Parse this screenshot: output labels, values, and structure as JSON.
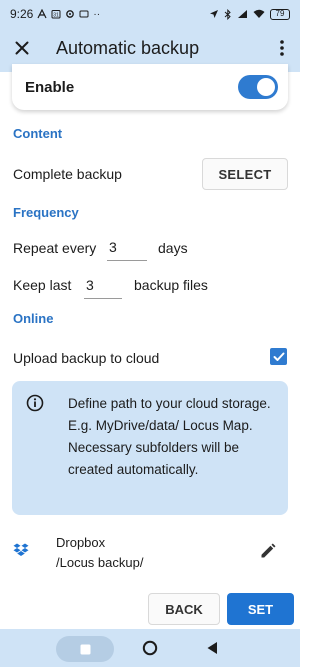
{
  "status_bar": {
    "time": "9:26",
    "battery": "79",
    "left_icons": [
      "app-icon",
      "calendar-icon",
      "settings-icon",
      "message-icon"
    ],
    "left_dots": "··",
    "right_icons": [
      "location-icon",
      "bluetooth-icon",
      "signal-icon",
      "wifi-icon",
      "battery-icon"
    ]
  },
  "toolbar": {
    "title": "Automatic backup",
    "close_icon": "close-icon",
    "more_icon": "more-vert-icon"
  },
  "enable": {
    "label": "Enable",
    "checked": true
  },
  "content": {
    "section_title": "Content",
    "complete_backup_label": "Complete backup",
    "select_label": "SELECT"
  },
  "frequency": {
    "section_title": "Frequency",
    "repeat_prefix": "Repeat every",
    "repeat_value": "3",
    "repeat_suffix": "days",
    "keep_prefix": "Keep last",
    "keep_value": "3",
    "keep_suffix": "backup files"
  },
  "online": {
    "section_title": "Online",
    "upload_label": "Upload backup to cloud",
    "upload_checked": true,
    "info_text": "Define path to your cloud storage. E.g. MyDrive/data/ Locus Map. Necessary subfolders will be created automatically."
  },
  "storage": {
    "name": "Dropbox",
    "path": "/Locus backup/"
  },
  "actions": {
    "back_label": "BACK",
    "set_label": "SET"
  },
  "colors": {
    "accent": "#2f7bd0",
    "section_title": "#2a73c4",
    "header_bg": "#cfe3f6",
    "set_button": "#1f74d2"
  }
}
